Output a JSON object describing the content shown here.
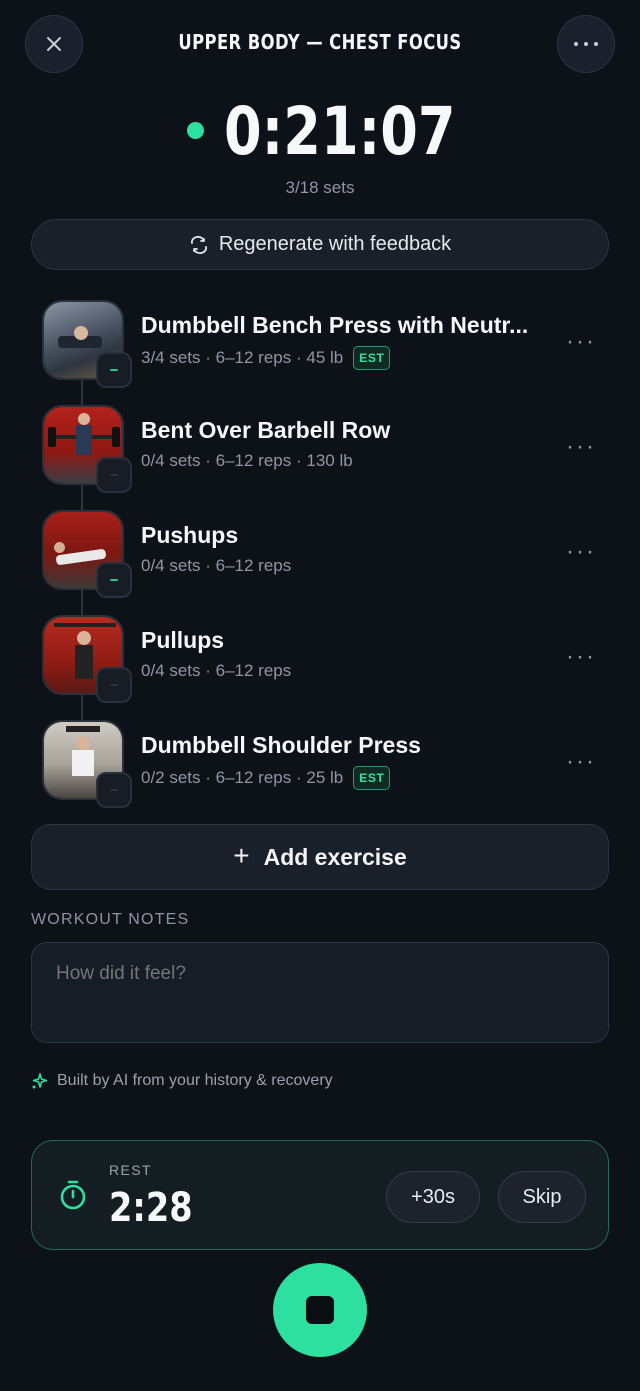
{
  "header": {
    "title": "UPPER BODY — CHEST FOCUS",
    "close_icon": "close-icon",
    "more_icon": "more-icon"
  },
  "timer": {
    "elapsed": "0:21:07",
    "sets_progress": "3/18 sets",
    "live_color": "#2ee0a0"
  },
  "regenerate": {
    "label": "Regenerate with feedback",
    "icon": "refresh-icon"
  },
  "exercises": [
    {
      "name": "Dumbbell Bench Press with Neutr...",
      "meta": "3/4 sets · 6–12 reps · 45 lb",
      "est": "EST"
    },
    {
      "name": "Bent Over Barbell Row",
      "meta": "0/4 sets · 6–12 reps · 130 lb"
    },
    {
      "name": "Pushups",
      "meta": "0/4 sets · 6–12 reps"
    },
    {
      "name": "Pullups",
      "meta": "0/4 sets · 6–12 reps"
    },
    {
      "name": "Dumbbell Shoulder Press",
      "meta": "0/2 sets · 6–12 reps · 25 lb",
      "est": "EST"
    }
  ],
  "add_exercise": {
    "label": "Add exercise",
    "plus": "+"
  },
  "notes": {
    "label": "WORKOUT NOTES",
    "placeholder": "How did it feel?"
  },
  "ai_note": {
    "text": "Built by AI from your history & recovery",
    "icon": "sparkle-icon"
  },
  "rest": {
    "label": "REST",
    "time": "2:28",
    "add_label": "+30s",
    "skip_label": "Skip",
    "icon": "stopwatch-icon",
    "accent": "#2ee0a0"
  },
  "stop_button": {
    "icon": "stop-icon"
  }
}
